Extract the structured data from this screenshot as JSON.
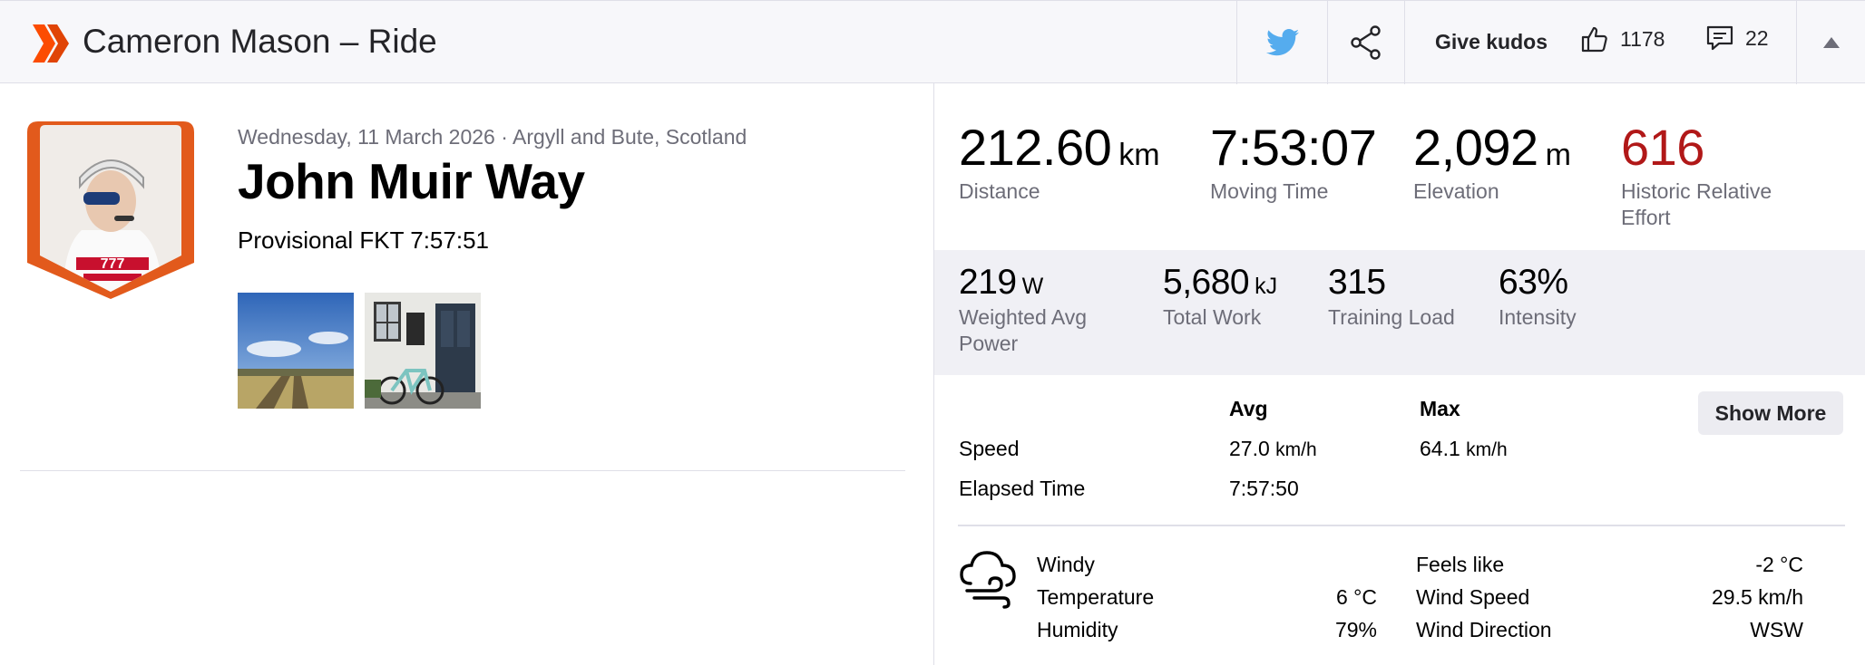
{
  "header": {
    "title": "Cameron Mason – Ride",
    "kudos_label": "Give kudos",
    "kudos_count": "1178",
    "comments_count": "22",
    "brand_color": "#fc4c02"
  },
  "activity": {
    "meta": "Wednesday, 11 March 2026 · Argyll and Bute, Scotland",
    "name": "John Muir Way",
    "description": "Provisional FKT 7:57:51"
  },
  "stats_primary": [
    {
      "value": "212.60",
      "unit": "km",
      "label": "Distance"
    },
    {
      "value": "7:53:07",
      "unit": "",
      "label": "Moving Time"
    },
    {
      "value": "2,092",
      "unit": "m",
      "label": "Elevation"
    },
    {
      "value": "616",
      "unit": "",
      "label": "Historic Relative",
      "label2": "Effort",
      "color": "#b11818"
    }
  ],
  "stats_secondary": [
    {
      "value": "219",
      "unit": "W",
      "label": "Weighted Avg",
      "label2": "Power"
    },
    {
      "value": "5,680",
      "unit": "kJ",
      "label": "Total Work"
    },
    {
      "value": "315",
      "unit": "",
      "label": "Training Load"
    },
    {
      "value": "63%",
      "unit": "",
      "label": "Intensity"
    }
  ],
  "details": {
    "col_avg": "Avg",
    "col_max": "Max",
    "show_more": "Show More",
    "rows": [
      {
        "label": "Speed",
        "avg": "27.0",
        "avg_unit": "km/h",
        "max": "64.1",
        "max_unit": "km/h"
      },
      {
        "label": "Elapsed Time",
        "avg": "7:57:50",
        "avg_unit": "",
        "max": "",
        "max_unit": ""
      }
    ]
  },
  "weather": {
    "condition": "Windy",
    "temperature_label": "Temperature",
    "temperature": "6 °C",
    "humidity_label": "Humidity",
    "humidity": "79%",
    "feels_like_label": "Feels like",
    "feels_like": "-2 °C",
    "wind_speed_label": "Wind Speed",
    "wind_speed": "29.5 km/h",
    "wind_direction_label": "Wind Direction",
    "wind_direction": "WSW"
  }
}
